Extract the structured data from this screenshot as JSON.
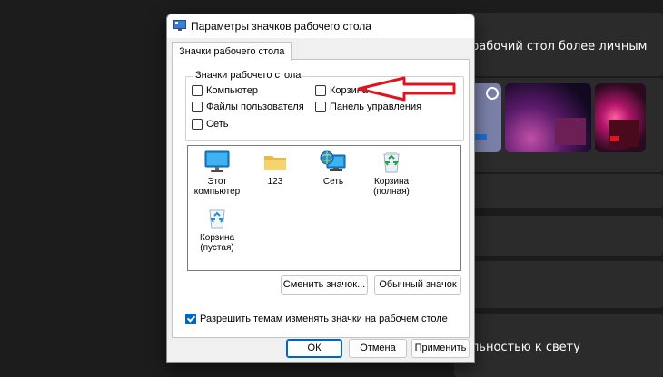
{
  "background": {
    "text_top": "рабочий стол более личным",
    "text_bottom": "льностью к свету"
  },
  "dialog": {
    "title": "Параметры значков рабочего стола",
    "tab": "Значки рабочего стола",
    "group_title": "Значки рабочего стола",
    "checkboxes": [
      {
        "label": "Компьютер",
        "checked": false
      },
      {
        "label": "Корзина",
        "checked": false
      },
      {
        "label": "Файлы пользователя",
        "checked": false
      },
      {
        "label": "Панель управления",
        "checked": false
      },
      {
        "label": "Сеть",
        "checked": false
      }
    ],
    "icons": [
      {
        "line1": "Этот",
        "line2": "компьютер"
      },
      {
        "line1": "123",
        "line2": ""
      },
      {
        "line1": "Сеть",
        "line2": ""
      },
      {
        "line1": "Корзина",
        "line2": "(полная)"
      },
      {
        "line1": "Корзина",
        "line2": "(пустая)"
      }
    ],
    "change_icon_button": "Сменить значок...",
    "default_icon_button": "Обычный значок",
    "allow_themes_label": "Разрешить темам изменять значки на рабочем столе",
    "allow_themes_checked": true,
    "ok_button": "ОК",
    "cancel_button": "Отмена",
    "apply_button": "Применить"
  },
  "colors": {
    "accent": "#0067c0",
    "arrow": "#e0141e"
  }
}
